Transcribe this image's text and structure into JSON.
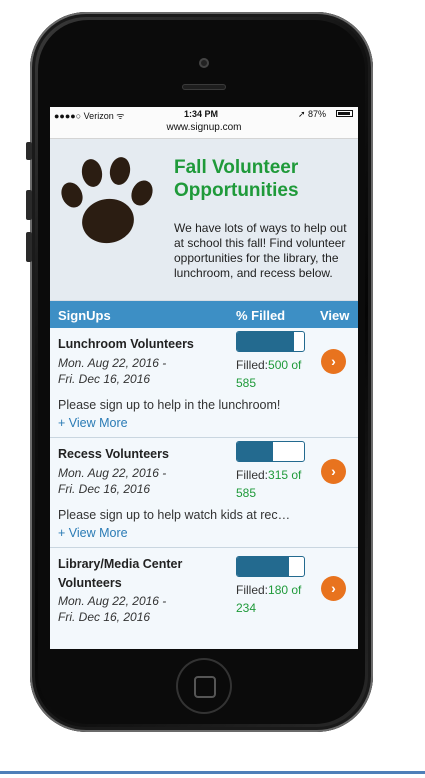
{
  "status_bar": {
    "carrier": "●●●●○ Verizon ᯤ",
    "time": "1:34 PM",
    "battery": "➚ 87%"
  },
  "url": "www.signup.com",
  "hero": {
    "title": "Fall Volunteer Opportunities",
    "description": "We have lots of ways to help out at school this fall! Find volunteer opportunities for the library, the lunchroom, and recess below."
  },
  "table_header": {
    "signups": "SignUps",
    "filled": "% Filled",
    "view": "View"
  },
  "signups": [
    {
      "title": "Lunchroom Volunteers",
      "date_line1": "Mon. Aug 22, 2016 -",
      "date_line2": "Fri. Dec 16, 2016",
      "filled_label": "Filled:",
      "filled_value": "500 of",
      "filled_total": "585",
      "fraction": 0.85,
      "description": "Please sign up to help in the lunchroom!",
      "more": "+ View More"
    },
    {
      "title": "Recess Volunteers",
      "date_line1": "Mon. Aug 22, 2016 -",
      "date_line2": "Fri. Dec 16, 2016",
      "filled_label": "Filled:",
      "filled_value": "315 of",
      "filled_total": "585",
      "fraction": 0.54,
      "description": "Please sign up to help watch kids at rec…",
      "more": "+ View More"
    },
    {
      "title_line1": "Library/Media Center",
      "title_line2": "Volunteers",
      "date_line1": "Mon. Aug 22, 2016 -",
      "date_line2": "Fri. Dec 16, 2016",
      "filled_label": "Filled:",
      "filled_value": "180 of",
      "filled_total": "234",
      "fraction": 0.77
    }
  ],
  "colors": {
    "accent_blue": "#3d8fc5",
    "title_green": "#1f9a3a",
    "button_orange": "#e8731e",
    "meter_blue": "#236a8f",
    "link_blue": "#2a7bb5"
  },
  "icons": {
    "paw": "paw-print-icon",
    "arrow": "chevron-right-icon"
  }
}
